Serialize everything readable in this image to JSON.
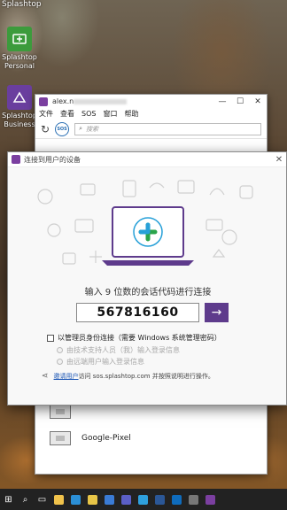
{
  "desktop": {
    "top_text": "Splashtop",
    "icons": [
      {
        "label_line1": "Splashtop",
        "label_line2": "Personal",
        "icon": "splashtop-personal-icon"
      },
      {
        "label_line1": "Splashtop",
        "label_line2": "Business",
        "icon": "splashtop-business-icon"
      }
    ]
  },
  "app_window": {
    "title": "alex.n",
    "menu": [
      "文件",
      "查看",
      "SOS",
      "窗口",
      "帮助"
    ],
    "window_controls": {
      "minimize": "—",
      "maximize": "☐",
      "close": "✕"
    },
    "search_placeholder": "搜索",
    "sos_label": "SOS",
    "devices": [
      "Google-Pixel"
    ]
  },
  "dialog": {
    "title": "连接到用户的设备",
    "close": "✕",
    "prompt": "输入 9 位数的会话代码进行连接",
    "code": "567816160",
    "go_arrow": "→",
    "admin_option": "以管理员身份连接（需要 Windows 系统管理密码）",
    "radio_1": "由技术支持人员（我）输入登录信息",
    "radio_2": "由远端用户输入登录信息",
    "invite_link": "邀请用户",
    "invite_text": "访问 sos.splashtop.com 并按照说明进行操作。"
  },
  "taskbar": {
    "items": [
      "windows-start-icon",
      "search-icon",
      "task-view-icon",
      "file-explorer-icon",
      "edge-icon",
      "chrome-icon",
      "store-icon",
      "teams-icon",
      "splashtop-icon",
      "word-icon",
      "outlook-icon",
      "app-icon",
      "splashtop-business-icon"
    ],
    "colors": [
      "#ffffff",
      "#ffffff",
      "#ffffff",
      "#f0c24b",
      "#2b8fd6",
      "#e8c547",
      "#3a7bd5",
      "#5b5fc7",
      "#2ea0dd",
      "#2b5797",
      "#0f6cbd",
      "#777777",
      "#7b3fa0"
    ]
  },
  "colors": {
    "accent": "#5e3b8c",
    "splashtop_purple": "#7b3fa0",
    "link": "#1a55b4"
  }
}
